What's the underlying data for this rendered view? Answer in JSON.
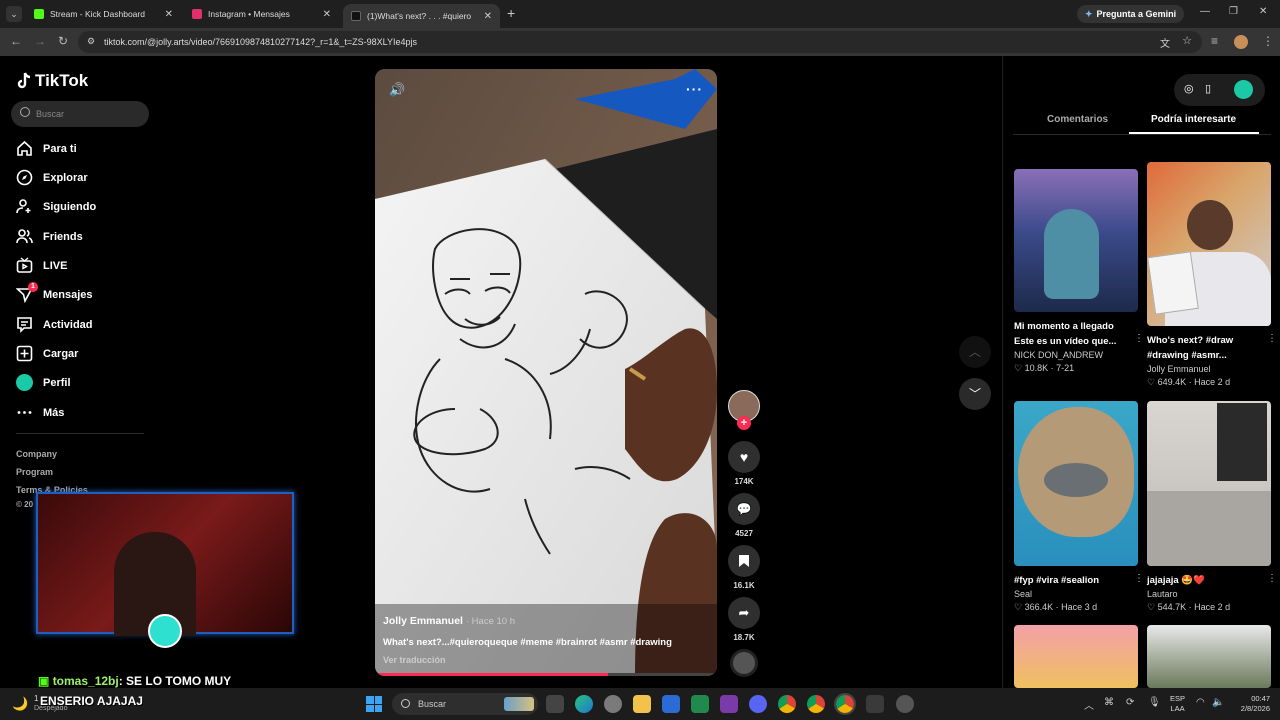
{
  "browser": {
    "tabs": [
      {
        "label": "Stream - Kick Dashboard",
        "favicon_color": "#53fc18"
      },
      {
        "label": "Instagram • Mensajes",
        "favicon_color": "#e1306c"
      },
      {
        "label": "(1)What's next? . . . #quiero",
        "favicon_color": "#111111"
      }
    ],
    "gemini_label": "Pregunta a Gemini",
    "url": "tiktok.com/@jolly.arts/video/7669109874810277142?_r=1&_t=ZS-98XLYIe4pjs"
  },
  "sidebar": {
    "logo": "TikTok",
    "search_placeholder": "Buscar",
    "nav": [
      {
        "label": "Para ti",
        "icon": "home-icon"
      },
      {
        "label": "Explorar",
        "icon": "compass-icon"
      },
      {
        "label": "Siguiendo",
        "icon": "following-icon"
      },
      {
        "label": "Friends",
        "icon": "friends-icon"
      },
      {
        "label": "LIVE",
        "icon": "live-icon"
      },
      {
        "label": "Mensajes",
        "icon": "messages-icon",
        "badge": "1"
      },
      {
        "label": "Actividad",
        "icon": "activity-icon"
      },
      {
        "label": "Cargar",
        "icon": "upload-icon"
      },
      {
        "label": "Perfil",
        "icon": "profile-avatar"
      },
      {
        "label": "Más",
        "icon": "more-icon"
      }
    ],
    "footer": [
      "Company",
      "Program",
      "Terms & Policies",
      "© 20"
    ]
  },
  "overlay": {
    "chat_user": "tomas_12bj",
    "chat_message_1": ": SE LO TOMO MUY",
    "chat_message_2": "ENSERIO AJAJAJ",
    "weather": "Despejado",
    "weather_temp": "1"
  },
  "video": {
    "author": "Jolly Emmanuel",
    "time": "· Hace 10 h",
    "caption": "What's next?...#quieroqueque #meme #brainrot #asmr #drawing",
    "translate": "Ver traducción",
    "likes": "174K",
    "comments": "4527",
    "saves": "16.1K",
    "shares": "18.7K"
  },
  "right": {
    "tabs": [
      "Comentarios",
      "Podría interesarte"
    ],
    "cards": [
      {
        "title1": "Mi momento a llegado",
        "title2": "Este es un vídeo que...",
        "author": "NICK DON_ANDREW",
        "likes": "10.8K",
        "date": "· 7-21"
      },
      {
        "title1": "Who's next? #draw",
        "title2": "#drawing #asmr...",
        "author": "Jolly Emmanuel",
        "likes": "649.4K",
        "date": "· Hace 2 d"
      },
      {
        "title1": "#fyp #vira #sealion",
        "title2": "",
        "author": "Seal",
        "likes": "366.4K",
        "date": "· Hace 3 d"
      },
      {
        "title1": "jajajaja 🤩❤️",
        "title2": "",
        "author": "Lautaro",
        "likes": "544.7K",
        "date": "· Hace 2 d"
      }
    ]
  },
  "taskbar": {
    "search": "Buscar",
    "lang1": "ESP",
    "lang2": "LAA",
    "time": "00:47",
    "date": "2/8/2026"
  },
  "colors": {
    "accent": "#fe2c55",
    "teal": "#25f4ee"
  }
}
